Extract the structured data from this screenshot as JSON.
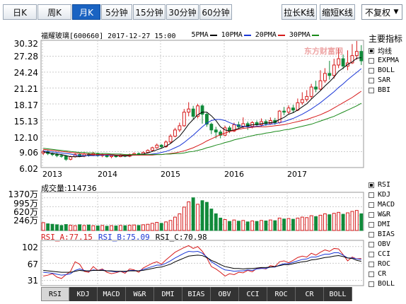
{
  "period_tabs": [
    {
      "name": "tab-day",
      "label": "日K",
      "active": false
    },
    {
      "name": "tab-week",
      "label": "周K",
      "active": false
    },
    {
      "name": "tab-month",
      "label": "月K",
      "active": true
    },
    {
      "name": "tab-5min",
      "label": "5分钟",
      "active": false
    },
    {
      "name": "tab-15min",
      "label": "15分钟",
      "active": false
    },
    {
      "name": "tab-30min",
      "label": "30分钟",
      "active": false
    },
    {
      "name": "tab-60min",
      "label": "60分钟",
      "active": false
    }
  ],
  "toolbar": {
    "stretch_label": "拉长K线",
    "shrink_label": "缩短K线",
    "adjust_select": "不复权"
  },
  "stock": {
    "title": "福耀玻璃[600660] 2017-12-27 15:00"
  },
  "ma_legend": [
    {
      "label": "5PMA",
      "color": "#000000"
    },
    {
      "label": "10PMA",
      "color": "#1a36d6"
    },
    {
      "label": "20PMA",
      "color": "#d61a1a"
    },
    {
      "label": "30PMA",
      "color": "#1a8a1a"
    }
  ],
  "watermark": "东方财富网",
  "indicators_title": "主要指标",
  "indicators": [
    {
      "name": "ma",
      "label": "均线",
      "checked": true
    },
    {
      "name": "expma",
      "label": "EXPMA",
      "checked": false
    },
    {
      "name": "boll",
      "label": "BOLL",
      "checked": false
    },
    {
      "name": "sar",
      "label": "SAR",
      "checked": false
    },
    {
      "name": "bbi",
      "label": "BBI",
      "checked": false
    }
  ],
  "sub_indicators": [
    {
      "name": "rsi",
      "label": "RSI",
      "checked": true
    },
    {
      "name": "kdj",
      "label": "KDJ",
      "checked": false
    },
    {
      "name": "macd",
      "label": "MACD",
      "checked": false
    },
    {
      "name": "wr",
      "label": "W&R",
      "checked": false
    },
    {
      "name": "dmi",
      "label": "DMI",
      "checked": false
    },
    {
      "name": "bias",
      "label": "BIAS",
      "checked": false
    },
    {
      "name": "obv",
      "label": "OBV",
      "checked": false
    },
    {
      "name": "cci",
      "label": "CCI",
      "checked": false
    },
    {
      "name": "roc",
      "label": "ROC",
      "checked": false
    },
    {
      "name": "cr",
      "label": "CR",
      "checked": false
    },
    {
      "name": "boll2",
      "label": "BOLL",
      "checked": false
    }
  ],
  "price_axis": [
    "30.32",
    "27.28",
    "24.24",
    "21.21",
    "18.17",
    "15.13",
    "12.10",
    "9.06",
    "6.02"
  ],
  "year_labels": [
    "2013",
    "2014",
    "2015",
    "2016",
    "2017"
  ],
  "volume": {
    "label": "成交量:114736",
    "axis": [
      "1370万",
      "995万",
      "620万",
      "246万"
    ]
  },
  "rsi": {
    "a": "RSI_A:77.15",
    "b": "RSI_B:75.09",
    "c": "RSI_C:70.98",
    "axis": [
      "102",
      "67",
      "31"
    ]
  },
  "bottom_tabs": [
    "RSI",
    "KDJ",
    "MACD",
    "W&R",
    "DMI",
    "BIAS",
    "OBV",
    "CCI",
    "ROC",
    "CR",
    "BOLL"
  ],
  "colors": {
    "up": "#d61a1a",
    "down": "#118a3a",
    "accent": "#1a63c2"
  },
  "chart_data": {
    "type": "candlestick",
    "title": "福耀玻璃[600660] 2017-12-27 15:00",
    "ylim": [
      6.02,
      30.32
    ],
    "candles": [
      [
        8.8,
        9.1,
        9.4,
        8.4
      ],
      [
        9.1,
        8.7,
        9.3,
        8.4
      ],
      [
        8.7,
        8.5,
        8.9,
        8.2
      ],
      [
        8.5,
        8.3,
        8.8,
        8.0
      ],
      [
        8.3,
        8.2,
        8.6,
        7.9
      ],
      [
        8.2,
        7.6,
        8.4,
        7.3
      ],
      [
        7.6,
        8.1,
        8.3,
        7.4
      ],
      [
        8.1,
        8.5,
        8.7,
        7.9
      ],
      [
        8.5,
        8.2,
        8.8,
        8.0
      ],
      [
        8.2,
        8.6,
        8.9,
        8.0
      ],
      [
        8.6,
        8.4,
        8.8,
        8.1
      ],
      [
        8.4,
        8.7,
        9.0,
        8.2
      ],
      [
        8.7,
        8.3,
        8.9,
        8.1
      ],
      [
        8.3,
        8.5,
        8.7,
        8.0
      ],
      [
        8.5,
        8.1,
        8.6,
        7.9
      ],
      [
        8.1,
        8.3,
        8.5,
        7.8
      ],
      [
        8.3,
        8.1,
        8.4,
        7.9
      ],
      [
        8.1,
        8.4,
        8.6,
        8.0
      ],
      [
        8.4,
        8.2,
        8.6,
        8.0
      ],
      [
        8.2,
        8.5,
        8.7,
        8.0
      ],
      [
        8.5,
        8.7,
        8.9,
        8.3
      ],
      [
        8.7,
        8.6,
        8.9,
        8.4
      ],
      [
        8.6,
        8.9,
        9.1,
        8.4
      ],
      [
        8.9,
        9.3,
        9.5,
        8.7
      ],
      [
        9.3,
        9.8,
        10.0,
        9.1
      ],
      [
        9.8,
        10.3,
        10.6,
        9.6
      ],
      [
        10.3,
        10.0,
        10.5,
        9.7
      ],
      [
        10.0,
        10.9,
        11.2,
        9.8
      ],
      [
        10.9,
        12.0,
        12.4,
        10.6
      ],
      [
        12.0,
        13.2,
        13.6,
        11.8
      ],
      [
        13.2,
        14.0,
        14.6,
        12.8
      ],
      [
        14.0,
        16.6,
        17.2,
        13.8
      ],
      [
        16.6,
        17.2,
        18.5,
        15.8
      ],
      [
        17.2,
        15.8,
        17.8,
        15.2
      ],
      [
        15.8,
        17.8,
        18.2,
        15.4
      ],
      [
        17.8,
        16.2,
        18.1,
        14.4
      ],
      [
        16.2,
        14.3,
        16.5,
        13.8
      ],
      [
        14.3,
        13.2,
        14.6,
        12.4
      ],
      [
        13.2,
        12.8,
        13.8,
        11.6
      ],
      [
        12.8,
        12.2,
        13.2,
        11.6
      ],
      [
        12.2,
        13.6,
        14.0,
        12.0
      ],
      [
        13.6,
        13.0,
        14.0,
        12.6
      ],
      [
        13.0,
        14.2,
        14.6,
        12.8
      ],
      [
        14.2,
        13.8,
        14.8,
        13.4
      ],
      [
        13.8,
        14.4,
        15.6,
        13.5
      ],
      [
        14.4,
        13.9,
        14.8,
        13.2
      ],
      [
        13.9,
        14.6,
        14.9,
        13.5
      ],
      [
        14.6,
        14.2,
        15.0,
        13.8
      ],
      [
        14.2,
        14.8,
        15.4,
        13.9
      ],
      [
        14.8,
        14.4,
        15.2,
        14.0
      ],
      [
        14.4,
        15.0,
        15.6,
        14.2
      ],
      [
        15.0,
        14.6,
        15.5,
        14.2
      ],
      [
        14.6,
        16.8,
        17.0,
        14.4
      ],
      [
        16.8,
        16.6,
        17.6,
        16.0
      ],
      [
        16.6,
        17.4,
        17.9,
        16.2
      ],
      [
        17.4,
        17.0,
        18.0,
        16.5
      ],
      [
        17.0,
        18.4,
        19.2,
        16.8
      ],
      [
        18.4,
        19.0,
        20.4,
        18.0
      ],
      [
        19.0,
        19.6,
        20.8,
        18.6
      ],
      [
        19.6,
        21.4,
        22.0,
        19.2
      ],
      [
        21.4,
        21.0,
        22.6,
        20.4
      ],
      [
        21.0,
        22.6,
        24.6,
        20.8
      ],
      [
        22.6,
        24.0,
        25.0,
        22.2
      ],
      [
        24.0,
        23.6,
        26.4,
        22.8
      ],
      [
        23.6,
        25.6,
        26.8,
        23.0
      ],
      [
        25.6,
        26.8,
        28.8,
        25.0
      ],
      [
        26.8,
        25.4,
        27.6,
        24.8
      ],
      [
        25.4,
        26.0,
        28.4,
        24.6
      ],
      [
        26.0,
        27.4,
        29.6,
        25.8
      ],
      [
        27.4,
        28.2,
        30.2,
        26.6
      ],
      [
        28.2,
        26.4,
        29.4,
        25.6
      ]
    ],
    "ma5": [
      9.0,
      8.9,
      8.7,
      8.6,
      8.5,
      8.3,
      8.1,
      8.1,
      8.1,
      8.2,
      8.4,
      8.5,
      8.5,
      8.5,
      8.4,
      8.4,
      8.3,
      8.3,
      8.2,
      8.3,
      8.4,
      8.5,
      8.6,
      8.8,
      9.1,
      9.4,
      9.7,
      10.1,
      10.6,
      11.3,
      12.0,
      13.1,
      14.3,
      15.2,
      16.1,
      16.6,
      16.6,
      15.9,
      15.0,
      13.8,
      13.2,
      13.0,
      13.2,
      13.5,
      13.8,
      14.0,
      14.2,
      14.2,
      14.4,
      14.5,
      14.6,
      14.7,
      15.2,
      15.6,
      16.2,
      16.5,
      17.0,
      17.6,
      18.2,
      19.1,
      19.9,
      20.7,
      21.6,
      22.4,
      23.3,
      24.4,
      25.0,
      25.7,
      26.2,
      26.9,
      27.0
    ],
    "ma10": [
      9.2,
      9.1,
      9.0,
      8.9,
      8.8,
      8.7,
      8.6,
      8.4,
      8.3,
      8.3,
      8.3,
      8.3,
      8.3,
      8.4,
      8.4,
      8.4,
      8.4,
      8.4,
      8.4,
      8.4,
      8.4,
      8.4,
      8.5,
      8.5,
      8.6,
      8.7,
      8.9,
      9.1,
      9.4,
      9.8,
      10.2,
      10.8,
      11.5,
      12.2,
      13.0,
      13.8,
      14.5,
      15.0,
      15.2,
      15.2,
      15.0,
      14.6,
      14.3,
      14.0,
      13.9,
      13.8,
      13.8,
      13.9,
      14.0,
      14.2,
      14.3,
      14.4,
      14.6,
      14.8,
      15.1,
      15.4,
      15.8,
      16.2,
      16.7,
      17.2,
      17.8,
      18.4,
      19.1,
      19.8,
      20.5,
      21.3,
      22.0,
      22.8,
      23.5,
      24.2,
      24.9
    ],
    "ma20": [
      9.5,
      9.4,
      9.3,
      9.2,
      9.1,
      9.0,
      8.9,
      8.8,
      8.7,
      8.6,
      8.6,
      8.5,
      8.5,
      8.5,
      8.5,
      8.5,
      8.4,
      8.4,
      8.4,
      8.4,
      8.4,
      8.4,
      8.4,
      8.4,
      8.4,
      8.5,
      8.5,
      8.6,
      8.7,
      8.8,
      9.0,
      9.2,
      9.5,
      9.8,
      10.2,
      10.6,
      11.1,
      11.5,
      11.9,
      12.3,
      12.6,
      12.9,
      13.1,
      13.3,
      13.5,
      13.6,
      13.7,
      13.8,
      13.8,
      13.8,
      13.9,
      14.0,
      14.1,
      14.2,
      14.4,
      14.6,
      14.8,
      15.0,
      15.2,
      15.5,
      15.8,
      16.1,
      16.5,
      16.9,
      17.4,
      17.9,
      18.4,
      18.9,
      19.4,
      20.0,
      20.6
    ],
    "ma30": [
      9.7,
      9.6,
      9.5,
      9.4,
      9.3,
      9.2,
      9.1,
      9.0,
      8.9,
      8.9,
      8.8,
      8.8,
      8.7,
      8.7,
      8.7,
      8.6,
      8.6,
      8.6,
      8.5,
      8.5,
      8.5,
      8.5,
      8.5,
      8.5,
      8.5,
      8.5,
      8.5,
      8.6,
      8.6,
      8.7,
      8.7,
      8.8,
      9.0,
      9.1,
      9.3,
      9.5,
      9.8,
      10.0,
      10.3,
      10.5,
      10.8,
      11.0,
      11.3,
      11.5,
      11.7,
      11.9,
      12.1,
      12.3,
      12.4,
      12.6,
      12.7,
      12.9,
      13.0,
      13.2,
      13.3,
      13.5,
      13.7,
      13.9,
      14.1,
      14.3,
      14.6,
      14.9,
      15.2,
      15.5,
      15.8,
      16.2,
      16.6,
      17.0,
      17.4,
      17.8,
      18.3
    ],
    "volume_ylim": [
      0,
      1600
    ],
    "volume_wan": [
      330,
      280,
      260,
      240,
      210,
      250,
      220,
      200,
      240,
      210,
      230,
      200,
      190,
      210,
      180,
      200,
      190,
      210,
      200,
      220,
      230,
      210,
      240,
      260,
      300,
      340,
      300,
      360,
      420,
      560,
      700,
      980,
      1200,
      1370,
      1100,
      1250,
      1180,
      900,
      700,
      520,
      460,
      380,
      440,
      390,
      420,
      360,
      400,
      380,
      420,
      400,
      440,
      410,
      520,
      480,
      500,
      470,
      520,
      560,
      540,
      620,
      580,
      640,
      700,
      660,
      720,
      760,
      680,
      740,
      800,
      840,
      700
    ],
    "rsi_ylim": [
      20,
      115
    ],
    "rsi_a": [
      40,
      42,
      45,
      38,
      35,
      43,
      50,
      70,
      65,
      50,
      48,
      60,
      52,
      55,
      48,
      45,
      47,
      50,
      46,
      55,
      53,
      48,
      57,
      62,
      67,
      70,
      65,
      74,
      82,
      90,
      95,
      100,
      104,
      98,
      102,
      92,
      78,
      60,
      55,
      48,
      40,
      45,
      43,
      48,
      47,
      52,
      49,
      56,
      57,
      55,
      62,
      60,
      70,
      72,
      68,
      73,
      79,
      82,
      80,
      88,
      84,
      90,
      95,
      92,
      98,
      97,
      85,
      72,
      80,
      76,
      77
    ],
    "rsi_b": [
      48,
      47,
      46,
      44,
      42,
      43,
      45,
      52,
      55,
      52,
      50,
      53,
      52,
      53,
      51,
      50,
      49,
      50,
      49,
      52,
      52,
      51,
      54,
      57,
      60,
      63,
      63,
      67,
      72,
      78,
      83,
      88,
      92,
      91,
      92,
      88,
      80,
      70,
      64,
      58,
      53,
      52,
      50,
      51,
      51,
      53,
      52,
      55,
      56,
      56,
      59,
      59,
      63,
      66,
      66,
      69,
      72,
      75,
      76,
      80,
      80,
      83,
      86,
      86,
      89,
      89,
      84,
      78,
      78,
      76,
      75
    ],
    "rsi_c": [
      52,
      51,
      50,
      49,
      48,
      48,
      48,
      50,
      52,
      51,
      51,
      52,
      52,
      52,
      51,
      51,
      50,
      50,
      50,
      51,
      51,
      51,
      52,
      54,
      56,
      58,
      59,
      62,
      65,
      70,
      74,
      78,
      82,
      83,
      84,
      83,
      79,
      73,
      69,
      64,
      60,
      58,
      56,
      56,
      55,
      56,
      56,
      57,
      58,
      58,
      59,
      60,
      62,
      64,
      64,
      66,
      68,
      70,
      71,
      74,
      75,
      77,
      79,
      80,
      82,
      83,
      81,
      78,
      77,
      73,
      71
    ]
  }
}
